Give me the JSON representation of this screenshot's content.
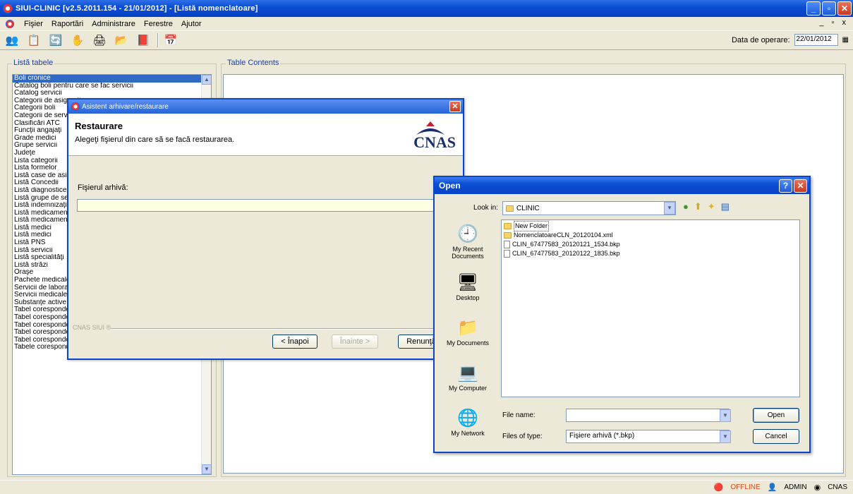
{
  "app": {
    "title": "SIUI-CLINIC [v2.5.2011.154 - 21/01/2012] - [Listă nomenclatoare]",
    "min": "_",
    "max": "▫",
    "close": "✕"
  },
  "menu": {
    "items": [
      "Fişier",
      "Raportări",
      "Administrare",
      "Ferestre",
      "Ajutor"
    ],
    "mdi_controls": "_ ▫ x"
  },
  "toolbar": {
    "icons": [
      "users-icon",
      "document-check-icon",
      "refresh-icon",
      "hand-icon",
      "print-icon",
      "clipboard-icon",
      "export-icon",
      "calendar-users-icon"
    ],
    "date_label": "Data de operare:",
    "date_value": "22/01/2012"
  },
  "left_panel": {
    "title": "Listă tabele",
    "items": [
      "Boli cronice",
      "Catalog boli pentru care se fac servicii",
      "Catalog servicii",
      "Categorii de asigurati",
      "Categorii boli",
      "Categorii de servicii",
      "Clasificări ATC",
      "Funcţii angajaţi",
      "Grade medici",
      "Grupe servicii",
      "Judeţe",
      "Lista categorii",
      "Lista formelor",
      "Listă case de asigurări",
      "Listă Concedii",
      "Listă diagnostice",
      "Listă grupe de servicii",
      "Listă indemnizaţii",
      "Listă medicamente",
      "Listă medicamente",
      "Listă medici",
      "Listă medici",
      "Listă PNS",
      "Listă servicii",
      "Listă specialităţi",
      "Listă străzi",
      "Oraşe",
      "Pachete medicale",
      "Servicii de laborator",
      "Servicii medicale",
      "Substanţe active",
      "Tabel corespondenţe între categoria de asigu",
      "Tabel corespondenţă între casele de asigură",
      "Tabel corespondenţă între grupe servicii şi sp",
      "Tabel corespondenţă între servicii spitaliceşti",
      "Tabel corespondeţă între servicii clinice şi pa",
      "Tabele corespondenţă între servicii de laborat"
    ]
  },
  "right_panel": {
    "title": "Table Contents"
  },
  "wizard": {
    "title": "Asistent arhivare/restaurare",
    "close": "✕",
    "heading": "Restaurare",
    "subheading": "Alegeţi fişierul din care să se facă restaurarea.",
    "logo_text": "CNAS",
    "file_label": "Fişierul arhivă:",
    "file_value": "",
    "footer_label": "CNAS SIUI ®",
    "back": "< Înapoi",
    "next": "Înainte >",
    "cancel": "Renunţă"
  },
  "open_dialog": {
    "title": "Open",
    "help": "?",
    "close": "✕",
    "look_in_label": "Look in:",
    "look_in_value": "CLINIC",
    "places": [
      {
        "label": "My Recent Documents",
        "icon": "recent-documents-icon"
      },
      {
        "label": "Desktop",
        "icon": "desktop-icon"
      },
      {
        "label": "My Documents",
        "icon": "my-documents-icon"
      },
      {
        "label": "My Computer",
        "icon": "my-computer-icon"
      },
      {
        "label": "My Network",
        "icon": "my-network-icon"
      }
    ],
    "files": [
      {
        "name": "New Folder",
        "type": "folder"
      },
      {
        "name": "NomenclatoareCLN_20120104.xml",
        "type": "folder"
      },
      {
        "name": "CLIN_67477583_20120121_1534.bkp",
        "type": "file"
      },
      {
        "name": "CLIN_67477583_20120122_1835.bkp",
        "type": "file"
      }
    ],
    "file_name_label": "File name:",
    "file_name_value": "",
    "file_type_label": "Files of type:",
    "file_type_value": "Fişiere arhivă (*.bkp)",
    "open_button": "Open",
    "cancel_button": "Cancel"
  },
  "status": {
    "offline": "OFFLINE",
    "user": "ADMIN",
    "org": "CNAS"
  }
}
